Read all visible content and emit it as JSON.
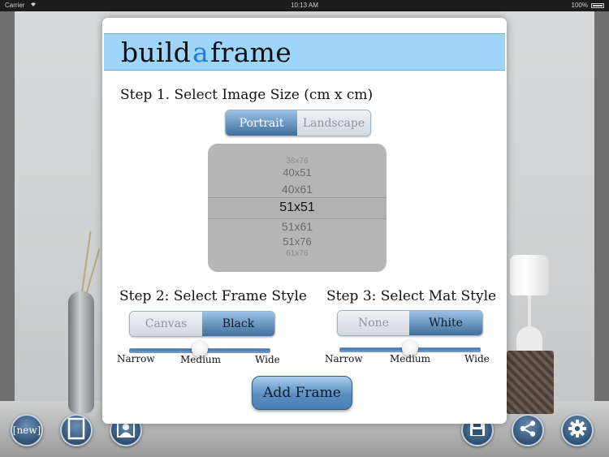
{
  "status_bar": {
    "carrier": "Carrier",
    "time": "10:13 AM",
    "battery": "100%"
  },
  "brand": {
    "part1": "build",
    "accent": "a",
    "part2": "frame",
    "accent_color": "#1e7fd6",
    "bar_color": "#9fd4fb"
  },
  "step1": {
    "title": "Step 1.  Select Image Size (cm x cm)",
    "orientation": {
      "options": [
        "Portrait",
        "Landscape"
      ],
      "selected": "Portrait"
    },
    "sizes": [
      "38x76",
      "40x51",
      "40x61",
      "51x51",
      "51x61",
      "51x76",
      "61x76"
    ],
    "selected_size": "51x51"
  },
  "step2": {
    "title": "Step 2:  Select Frame Style",
    "style": {
      "options": [
        "Canvas",
        "Black"
      ],
      "selected": "Black"
    },
    "width_slider": {
      "labels": [
        "Narrow",
        "Medium",
        "Wide"
      ],
      "value": "Medium"
    }
  },
  "step3": {
    "title": "Step 3:  Select Mat Style",
    "style": {
      "options": [
        "None",
        "White"
      ],
      "selected": "White"
    },
    "width_slider": {
      "labels": [
        "Narrow",
        "Medium",
        "Wide"
      ],
      "value": "Medium"
    }
  },
  "add_button": "Add Frame",
  "toolbar": {
    "new_label": "[new]",
    "icons": [
      "frame-icon",
      "portrait-icon",
      "save-icon",
      "share-icon",
      "gear-icon"
    ]
  }
}
